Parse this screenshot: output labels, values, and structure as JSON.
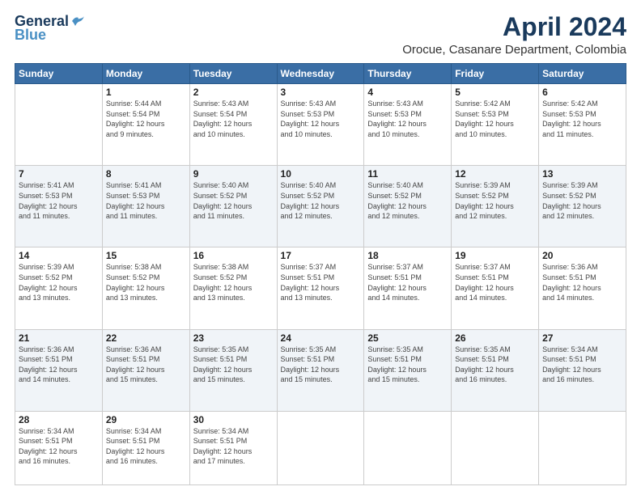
{
  "header": {
    "logo_line1": "General",
    "logo_line2": "Blue",
    "month_year": "April 2024",
    "location": "Orocue, Casanare Department, Colombia"
  },
  "days_of_week": [
    "Sunday",
    "Monday",
    "Tuesday",
    "Wednesday",
    "Thursday",
    "Friday",
    "Saturday"
  ],
  "weeks": [
    [
      {
        "day": "",
        "info": ""
      },
      {
        "day": "1",
        "info": "Sunrise: 5:44 AM\nSunset: 5:54 PM\nDaylight: 12 hours\nand 9 minutes."
      },
      {
        "day": "2",
        "info": "Sunrise: 5:43 AM\nSunset: 5:54 PM\nDaylight: 12 hours\nand 10 minutes."
      },
      {
        "day": "3",
        "info": "Sunrise: 5:43 AM\nSunset: 5:53 PM\nDaylight: 12 hours\nand 10 minutes."
      },
      {
        "day": "4",
        "info": "Sunrise: 5:43 AM\nSunset: 5:53 PM\nDaylight: 12 hours\nand 10 minutes."
      },
      {
        "day": "5",
        "info": "Sunrise: 5:42 AM\nSunset: 5:53 PM\nDaylight: 12 hours\nand 10 minutes."
      },
      {
        "day": "6",
        "info": "Sunrise: 5:42 AM\nSunset: 5:53 PM\nDaylight: 12 hours\nand 11 minutes."
      }
    ],
    [
      {
        "day": "7",
        "info": "Sunrise: 5:41 AM\nSunset: 5:53 PM\nDaylight: 12 hours\nand 11 minutes."
      },
      {
        "day": "8",
        "info": "Sunrise: 5:41 AM\nSunset: 5:53 PM\nDaylight: 12 hours\nand 11 minutes."
      },
      {
        "day": "9",
        "info": "Sunrise: 5:40 AM\nSunset: 5:52 PM\nDaylight: 12 hours\nand 11 minutes."
      },
      {
        "day": "10",
        "info": "Sunrise: 5:40 AM\nSunset: 5:52 PM\nDaylight: 12 hours\nand 12 minutes."
      },
      {
        "day": "11",
        "info": "Sunrise: 5:40 AM\nSunset: 5:52 PM\nDaylight: 12 hours\nand 12 minutes."
      },
      {
        "day": "12",
        "info": "Sunrise: 5:39 AM\nSunset: 5:52 PM\nDaylight: 12 hours\nand 12 minutes."
      },
      {
        "day": "13",
        "info": "Sunrise: 5:39 AM\nSunset: 5:52 PM\nDaylight: 12 hours\nand 12 minutes."
      }
    ],
    [
      {
        "day": "14",
        "info": "Sunrise: 5:39 AM\nSunset: 5:52 PM\nDaylight: 12 hours\nand 13 minutes."
      },
      {
        "day": "15",
        "info": "Sunrise: 5:38 AM\nSunset: 5:52 PM\nDaylight: 12 hours\nand 13 minutes."
      },
      {
        "day": "16",
        "info": "Sunrise: 5:38 AM\nSunset: 5:52 PM\nDaylight: 12 hours\nand 13 minutes."
      },
      {
        "day": "17",
        "info": "Sunrise: 5:37 AM\nSunset: 5:51 PM\nDaylight: 12 hours\nand 13 minutes."
      },
      {
        "day": "18",
        "info": "Sunrise: 5:37 AM\nSunset: 5:51 PM\nDaylight: 12 hours\nand 14 minutes."
      },
      {
        "day": "19",
        "info": "Sunrise: 5:37 AM\nSunset: 5:51 PM\nDaylight: 12 hours\nand 14 minutes."
      },
      {
        "day": "20",
        "info": "Sunrise: 5:36 AM\nSunset: 5:51 PM\nDaylight: 12 hours\nand 14 minutes."
      }
    ],
    [
      {
        "day": "21",
        "info": "Sunrise: 5:36 AM\nSunset: 5:51 PM\nDaylight: 12 hours\nand 14 minutes."
      },
      {
        "day": "22",
        "info": "Sunrise: 5:36 AM\nSunset: 5:51 PM\nDaylight: 12 hours\nand 15 minutes."
      },
      {
        "day": "23",
        "info": "Sunrise: 5:35 AM\nSunset: 5:51 PM\nDaylight: 12 hours\nand 15 minutes."
      },
      {
        "day": "24",
        "info": "Sunrise: 5:35 AM\nSunset: 5:51 PM\nDaylight: 12 hours\nand 15 minutes."
      },
      {
        "day": "25",
        "info": "Sunrise: 5:35 AM\nSunset: 5:51 PM\nDaylight: 12 hours\nand 15 minutes."
      },
      {
        "day": "26",
        "info": "Sunrise: 5:35 AM\nSunset: 5:51 PM\nDaylight: 12 hours\nand 16 minutes."
      },
      {
        "day": "27",
        "info": "Sunrise: 5:34 AM\nSunset: 5:51 PM\nDaylight: 12 hours\nand 16 minutes."
      }
    ],
    [
      {
        "day": "28",
        "info": "Sunrise: 5:34 AM\nSunset: 5:51 PM\nDaylight: 12 hours\nand 16 minutes."
      },
      {
        "day": "29",
        "info": "Sunrise: 5:34 AM\nSunset: 5:51 PM\nDaylight: 12 hours\nand 16 minutes."
      },
      {
        "day": "30",
        "info": "Sunrise: 5:34 AM\nSunset: 5:51 PM\nDaylight: 12 hours\nand 17 minutes."
      },
      {
        "day": "",
        "info": ""
      },
      {
        "day": "",
        "info": ""
      },
      {
        "day": "",
        "info": ""
      },
      {
        "day": "",
        "info": ""
      }
    ]
  ]
}
